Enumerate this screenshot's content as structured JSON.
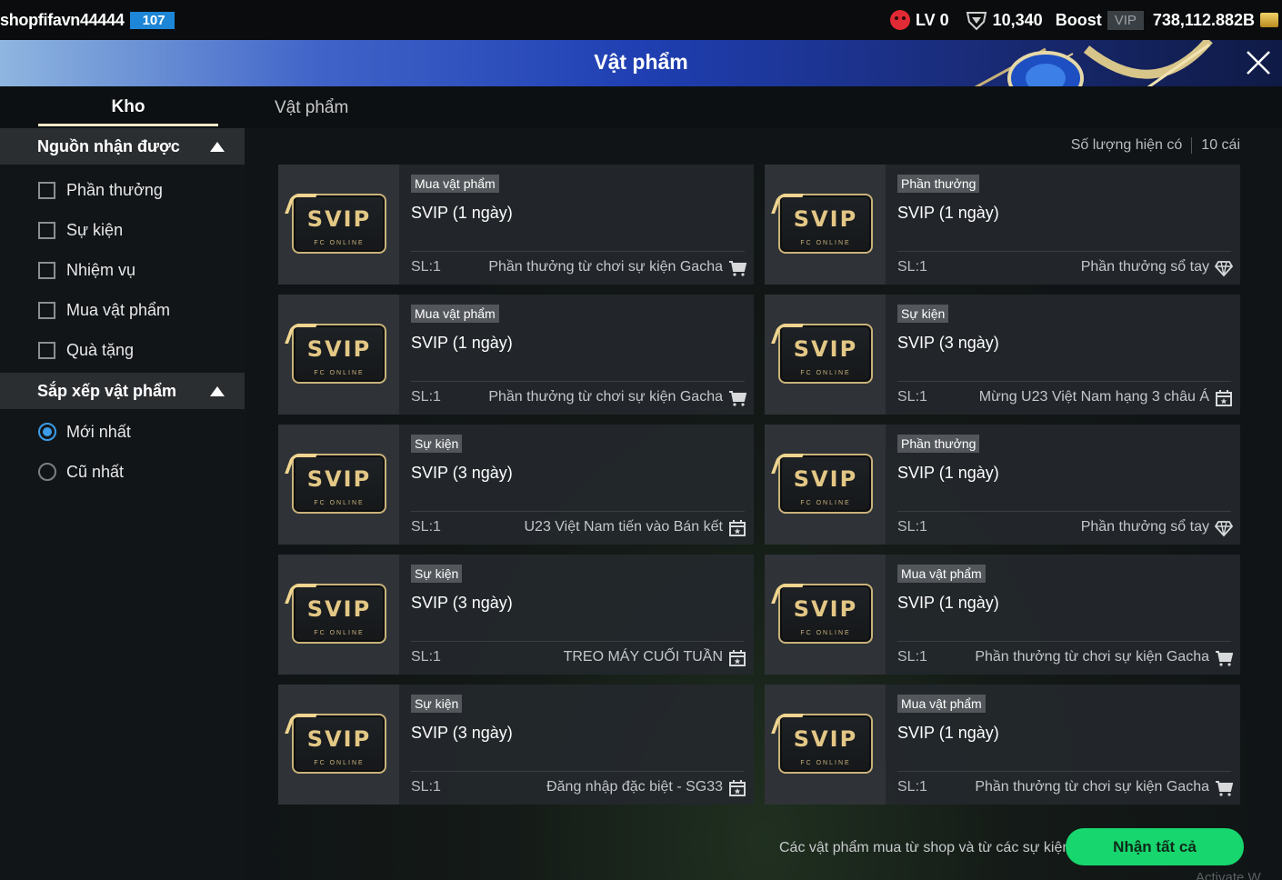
{
  "topbar": {
    "username": "shopfifavn44444",
    "level_badge": "107",
    "lv": "LV 0",
    "points": "10,340",
    "boost": "Boost",
    "vip": "VIP",
    "balance": "738,112.882B"
  },
  "header": {
    "title": "Vật phẩm"
  },
  "tabs": {
    "kho": "Kho",
    "vatpham": "Vật phẩm"
  },
  "sidebar": {
    "source_title": "Nguồn nhận được",
    "sources": [
      "Phần thưởng",
      "Sự kiện",
      "Nhiệm vụ",
      "Mua vật phẩm",
      "Quà tặng"
    ],
    "sort_title": "Sắp xếp vật phẩm",
    "sort_options": [
      "Mới nhất",
      "Cũ nhất"
    ],
    "sort_selected": "Mới nhất"
  },
  "main": {
    "count_label": "Số lượng hiện có",
    "count_value": "10 cái",
    "footer_note": "Các vật phẩm mua từ shop và từ các sự kiện.",
    "claim_all": "Nhận tất cả",
    "watermark": "Activate W"
  },
  "svip": {
    "logo": "SVIP",
    "sub": "FC ONLINE"
  },
  "items": [
    {
      "tag": "Mua vật phẩm",
      "title": "SVIP (1 ngày)",
      "qty": "SL:1",
      "source": "Phần thưởng từ chơi sự kiện Gacha",
      "icon": "cart-icon"
    },
    {
      "tag": "Phần thưởng",
      "title": "SVIP (1 ngày)",
      "qty": "SL:1",
      "source": "Phần thưởng sổ tay",
      "icon": "diamond-icon"
    },
    {
      "tag": "Mua vật phẩm",
      "title": "SVIP (1 ngày)",
      "qty": "SL:1",
      "source": "Phần thưởng từ chơi sự kiện Gacha",
      "icon": "cart-icon"
    },
    {
      "tag": "Sự kiện",
      "title": "SVIP (3 ngày)",
      "qty": "SL:1",
      "source": "Mừng U23 Việt Nam hạng 3 châu Á",
      "icon": "calendar-icon"
    },
    {
      "tag": "Sự kiện",
      "title": "SVIP (3 ngày)",
      "qty": "SL:1",
      "source": "U23 Việt Nam tiến vào Bán kết",
      "icon": "calendar-icon"
    },
    {
      "tag": "Phần thưởng",
      "title": "SVIP (1 ngày)",
      "qty": "SL:1",
      "source": "Phần thưởng sổ tay",
      "icon": "diamond-icon"
    },
    {
      "tag": "Sự kiện",
      "title": "SVIP (3 ngày)",
      "qty": "SL:1",
      "source": "TREO MÁY CUỐI TUẦN",
      "icon": "calendar-icon"
    },
    {
      "tag": "Mua vật phẩm",
      "title": "SVIP (1 ngày)",
      "qty": "SL:1",
      "source": "Phần thưởng từ chơi sự kiện Gacha",
      "icon": "cart-icon"
    },
    {
      "tag": "Sự kiện",
      "title": "SVIP (3 ngày)",
      "qty": "SL:1",
      "source": "Đăng nhập đặc biệt - SG33",
      "icon": "calendar-icon"
    },
    {
      "tag": "Mua vật phẩm",
      "title": "SVIP (1 ngày)",
      "qty": "SL:1",
      "source": "Phần thưởng từ chơi sự kiện Gacha",
      "icon": "cart-icon"
    }
  ]
}
